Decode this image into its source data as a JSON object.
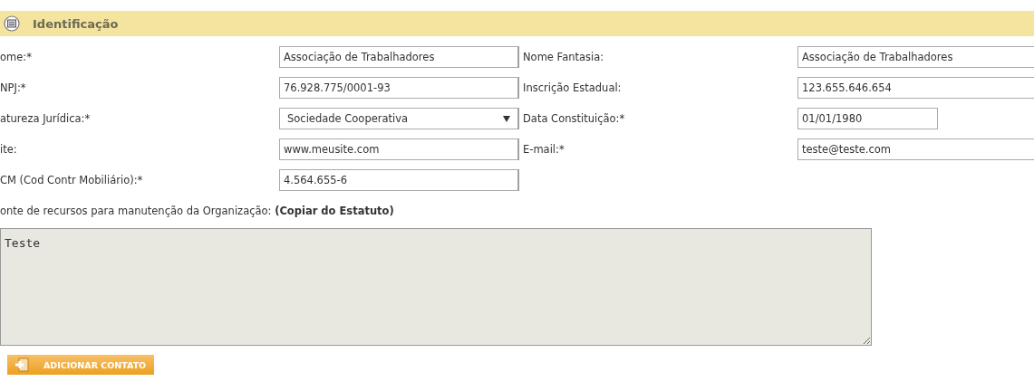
{
  "section": {
    "title": "Identificação"
  },
  "rows": [
    {
      "left": {
        "label": "ome:*",
        "value": "Associação de Trabalhadores",
        "kind": "text"
      },
      "right": {
        "label": "Nome Fantasia:",
        "value": "Associação de Trabalhadores",
        "kind": "text"
      }
    },
    {
      "left": {
        "label": "NPJ:*",
        "value": "76.928.775/0001-93",
        "kind": "text"
      },
      "right": {
        "label": "Inscrição Estadual:",
        "value": "123.655.646.654",
        "kind": "text"
      }
    },
    {
      "left": {
        "label": "atureza Jurídica:*",
        "value": "Sociedade Cooperativa",
        "kind": "select"
      },
      "right": {
        "label": "Data Constituição:*",
        "value": "01/01/1980",
        "kind": "short"
      }
    },
    {
      "left": {
        "label": "ite:",
        "value": "www.meusite.com",
        "kind": "text"
      },
      "right": {
        "label": "E-mail:*",
        "value": "teste@teste.com",
        "kind": "text"
      }
    },
    {
      "left": {
        "label": "CM (Cod Contr Mobiliário):*",
        "value": "4.564.655-6",
        "kind": "text"
      }
    }
  ],
  "resources": {
    "label": "onte de recursos para manutenção da Organização: **(Copiar do Estatuto)**",
    "value": "Teste"
  },
  "button": {
    "label": "ADICIONAR CONTATO"
  }
}
